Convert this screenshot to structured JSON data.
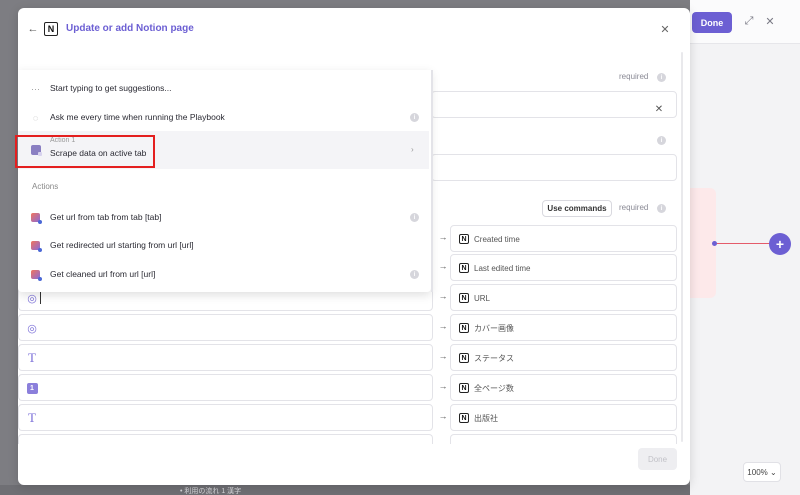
{
  "modal": {
    "title": "Update or add Notion page",
    "notion_glyph": "N",
    "required_label": "required",
    "use_commands_label": "Use commands",
    "footer_done_label": "Done"
  },
  "dropdown": {
    "hint": "Start typing to get suggestions...",
    "ask_label": "Ask me every time when running the Playbook",
    "selected": {
      "sub": "Action 1",
      "main": "Scrape data on active tab"
    },
    "section_title": "Actions",
    "actions": [
      {
        "label": "Get url from tab from tab [tab]",
        "info": true
      },
      {
        "label": "Get redirected url starting from url [url]",
        "info": false
      },
      {
        "label": "Get cleaned url from url [url]",
        "info": true
      }
    ]
  },
  "mappings": [
    {
      "left_icon": "",
      "target": "Created time"
    },
    {
      "left_icon": "",
      "target": "Last edited time"
    },
    {
      "left_icon": "globe-icon",
      "target": "URL",
      "cursor": true
    },
    {
      "left_icon": "globe-icon",
      "target": "カバー画像"
    },
    {
      "left_icon": "text-icon",
      "target": "ステータス"
    },
    {
      "left_icon": "number-icon",
      "target": "全ページ数"
    },
    {
      "left_icon": "text-icon",
      "target": "出版社"
    }
  ],
  "canvas": {
    "done_label": "Done",
    "zoom_label": "100%"
  },
  "bottom_text": "• 利用の流れ 1 漢字"
}
